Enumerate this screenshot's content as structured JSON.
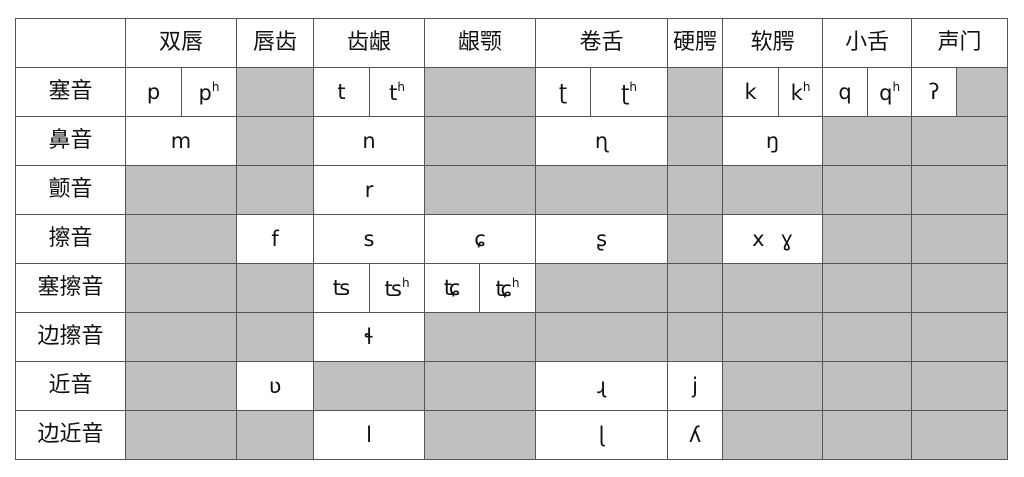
{
  "col_headers": [
    "",
    "双唇",
    "唇齿",
    "齿龈",
    "龈颚",
    "卷舌",
    "硬腭",
    "软腭",
    "小舌",
    "声门"
  ],
  "rows": {
    "plosive": {
      "label": "塞音",
      "bilabial_a": "p",
      "bilabial_b": "p",
      "bilabial_b_sup": "h",
      "alveolar_a": "t",
      "alveolar_b": "t",
      "alveolar_b_sup": "h",
      "retroflex_a": "ʈ",
      "retroflex_b": "ʈ",
      "retroflex_b_sup": "h",
      "velar_a": "k",
      "velar_b": "k",
      "velar_b_sup": "h",
      "uvular_a": "q",
      "uvular_b": "q",
      "uvular_b_sup": "h",
      "glottal_a": "ʔ"
    },
    "nasal": {
      "label": "鼻音",
      "bilabial": "m",
      "alveolar": "n",
      "retroflex": "ɳ",
      "velar": "ŋ"
    },
    "trill": {
      "label": "颤音",
      "alveolar": "r"
    },
    "fricative": {
      "label": "擦音",
      "labiodental": "f",
      "alveolar": "s",
      "alveolopalatal": "ɕ",
      "retroflex": "ʂ",
      "velar_a": "x",
      "velar_b": "ɣ"
    },
    "affricate": {
      "label": "塞擦音",
      "alveolar_a": "ʦ",
      "alveolar_b": "ʦ",
      "alveolar_b_sup": "h",
      "alveolopalatal_a": "ʨ",
      "alveolopalatal_b": "ʨ",
      "alveolopalatal_b_sup": "h"
    },
    "lateral_fricative": {
      "label": "边擦音",
      "alveolar": "ɬ"
    },
    "approximant": {
      "label": "近音",
      "labiodental": "ʋ",
      "retroflex": "ɻ",
      "palatal": "j"
    },
    "lateral_approximant": {
      "label": "边近音",
      "alveolar": "l",
      "retroflex": "ɭ",
      "palatal": "ʎ"
    }
  },
  "colors": {
    "filled": "#c0c0c0",
    "empty": "#ffffff",
    "border": "#555555"
  }
}
